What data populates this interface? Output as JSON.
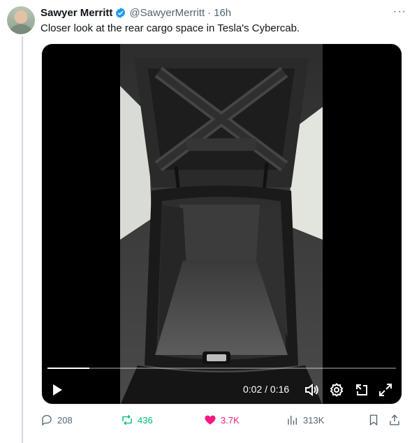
{
  "tweet": {
    "author_name": "Sawyer Merritt",
    "author_handle": "@SawyerMerritt",
    "separator": "·",
    "timestamp": "16h",
    "more_label": "···",
    "text": "Closer look at the rear cargo space in Tesla's Cybercab."
  },
  "video": {
    "time_display": "0:02 / 0:16",
    "progress": 0.12,
    "icons": [
      "play-icon",
      "volume-icon",
      "settings-icon",
      "picture-in-picture-icon",
      "fullscreen-icon"
    ]
  },
  "actions": {
    "replies": "208",
    "reposts": "436",
    "likes": "3.7K",
    "views": "313K",
    "colors": {
      "repost": "#00ba7c",
      "like": "#f91880",
      "neutral": "#536471"
    }
  },
  "colors": {
    "verified": "#1d9bf0",
    "text": "#0f1419",
    "muted": "#536471"
  }
}
